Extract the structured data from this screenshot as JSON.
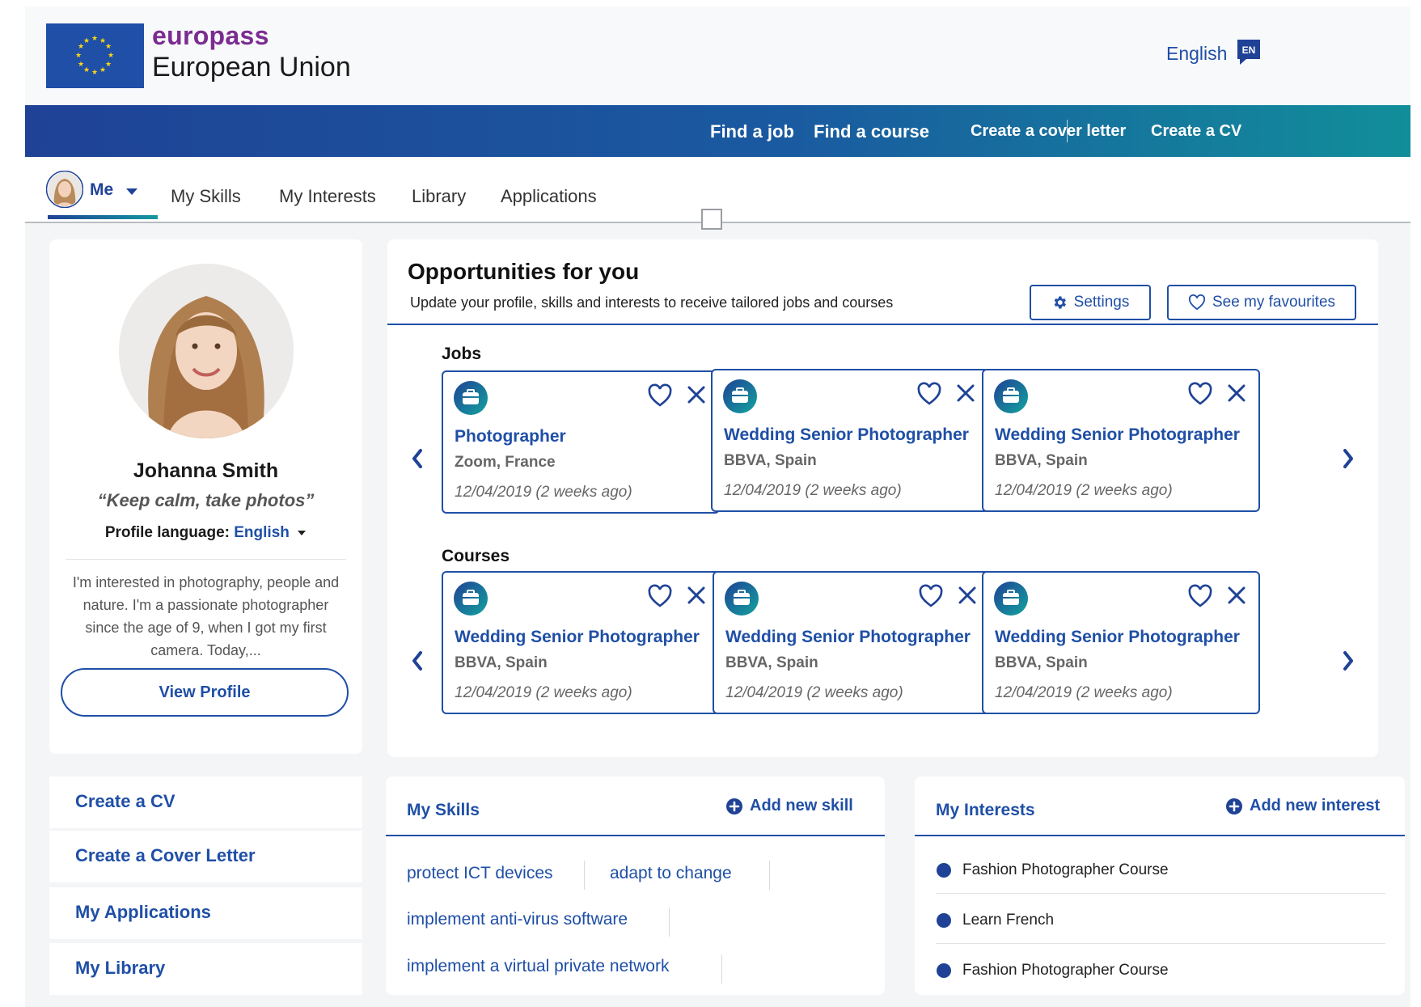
{
  "header": {
    "brand_name": "europass",
    "brand_sub": "European Union",
    "language_label": "English",
    "language_badge": "EN"
  },
  "main_nav": {
    "items": [
      "Find a job",
      "Find a course",
      "Create a cover letter",
      "Create a CV"
    ]
  },
  "sub_nav": {
    "me_label": "Me",
    "tabs": [
      "My Skills",
      "My Interests",
      "Library",
      "Applications"
    ]
  },
  "profile": {
    "name": "Johanna Smith",
    "quote": "“Keep calm, take photos”",
    "language_label": "Profile language:",
    "language_value": "English",
    "bio": "I'm interested in photography, people and nature. I'm a passionate photographer since the age of 9, when I got my first camera. Today,...",
    "view_profile_label": "View Profile"
  },
  "quick_links": [
    "Create a CV",
    "Create a Cover Letter",
    "My Applications",
    "My Library"
  ],
  "opportunities": {
    "title": "Opportunities for you",
    "subtitle": "Update your profile, skills and interests to receive tailored jobs and courses",
    "settings_label": "Settings",
    "favourites_label": "See my favourites",
    "jobs_label": "Jobs",
    "courses_label": "Courses",
    "jobs": [
      {
        "title": "Photographer",
        "org": "Zoom, France",
        "date": "12/04/2019 (2 weeks ago)"
      },
      {
        "title": "Wedding Senior Photographer",
        "org": "BBVA, Spain",
        "date": "12/04/2019 (2 weeks ago)"
      },
      {
        "title": "Wedding Senior Photographer",
        "org": "BBVA, Spain",
        "date": "12/04/2019 (2 weeks ago)"
      }
    ],
    "courses": [
      {
        "title": "Wedding Senior Photographer",
        "org": "BBVA, Spain",
        "date": "12/04/2019 (2 weeks ago)"
      },
      {
        "title": "Wedding Senior Photographer",
        "org": "BBVA, Spain",
        "date": "12/04/2019 (2 weeks ago)"
      },
      {
        "title": "Wedding Senior Photographer",
        "org": "BBVA, Spain",
        "date": "12/04/2019 (2 weeks ago)"
      }
    ]
  },
  "skills": {
    "title": "My Skills",
    "add_label": "Add new skill",
    "items": [
      "protect ICT devices",
      "adapt to change",
      "implement anti-virus software",
      "implement a virtual private network"
    ]
  },
  "interests": {
    "title": "My Interests",
    "add_label": "Add new interest",
    "items": [
      "Fashion Photographer Course",
      "Learn French",
      "Fashion Photographer Course"
    ]
  },
  "colors": {
    "brand_purple": "#7b2c91",
    "primary_blue": "#1f4fa6",
    "nav_gradient_start": "#1f4296",
    "nav_gradient_end": "#118e9a"
  }
}
